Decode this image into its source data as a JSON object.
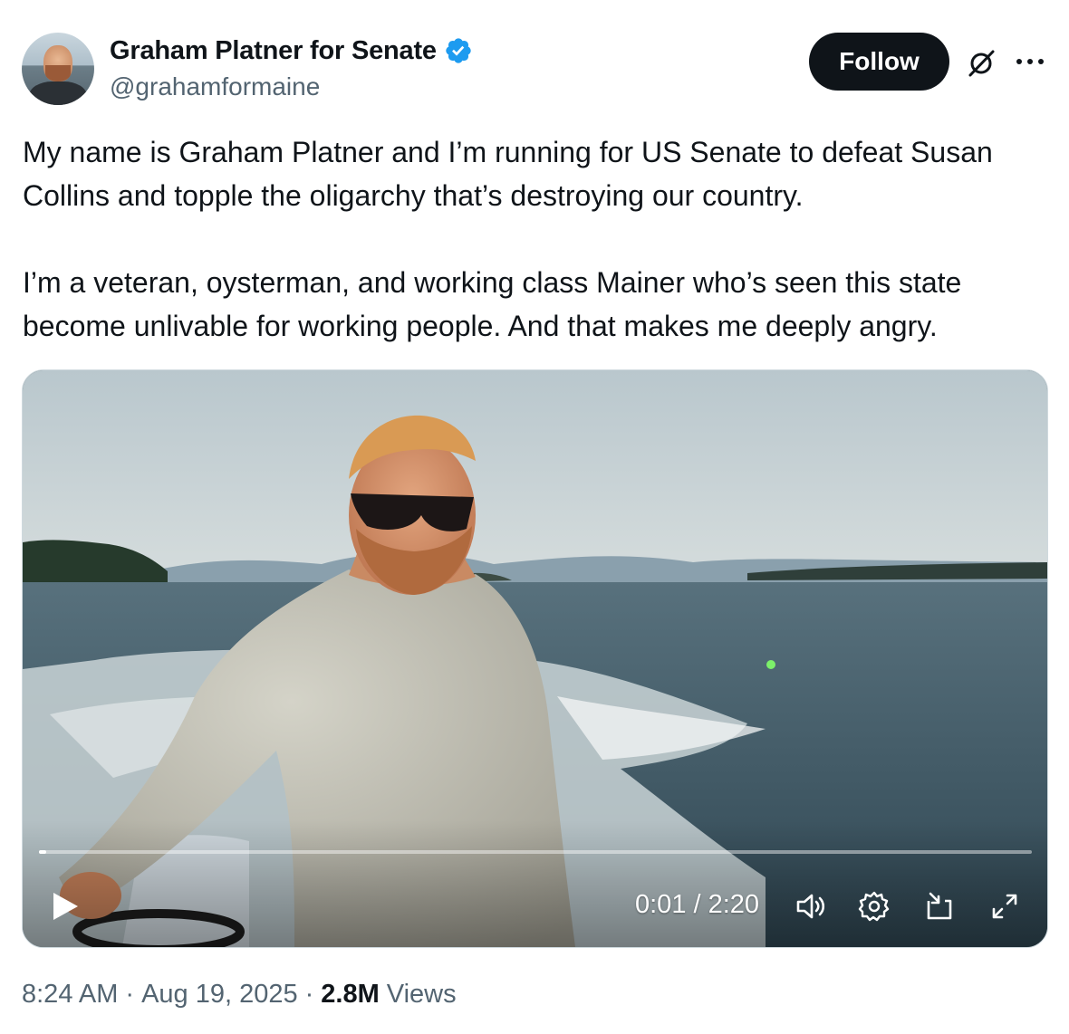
{
  "author": {
    "display_name": "Graham Platner for Senate",
    "handle": "@grahamformaine",
    "verified": true,
    "verified_color": "#1d9bf0"
  },
  "actions": {
    "follow_label": "Follow"
  },
  "tweet": {
    "paragraphs": [
      "My name is Graham Platner and I’m running for US Senate to defeat Susan Collins and topple the oligarchy that’s destroying our country.",
      "I’m a veteran, oysterman, and working class Mainer who’s seen this state become unlivable for working people. And that makes me deeply angry."
    ]
  },
  "video": {
    "time_display": "0:01 / 2:20",
    "progress_fraction": 0.0071,
    "icons": [
      "play-icon",
      "volume-icon",
      "settings-gear-icon",
      "picture-in-picture-icon",
      "fullscreen-icon"
    ]
  },
  "meta": {
    "time": "8:24 AM",
    "separator": "·",
    "date": "Aug 19, 2025",
    "views_count": "2.8M",
    "views_label": "Views"
  }
}
